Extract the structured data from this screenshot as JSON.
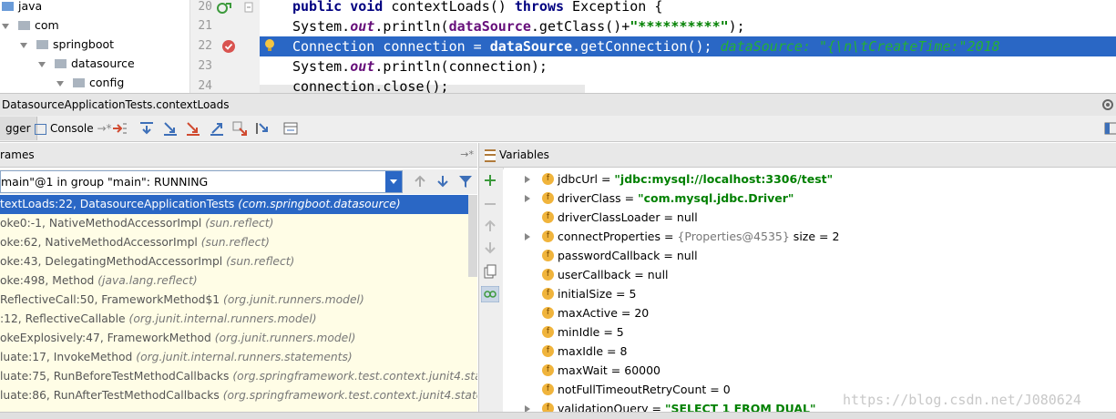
{
  "tree": {
    "items": [
      {
        "label": "java",
        "expanded": false
      },
      {
        "label": "com",
        "expanded": true
      },
      {
        "label": "springboot",
        "expanded": true
      },
      {
        "label": "datasource",
        "expanded": true
      },
      {
        "label": "config",
        "expanded": true
      }
    ]
  },
  "editor": {
    "line_numbers": [
      "20",
      "21",
      "22",
      "23",
      "24"
    ],
    "line20": {
      "kw1": "public void",
      "name": " contextLoads() ",
      "kw2": "throws",
      "rest": "  Exception {"
    },
    "line21": {
      "pre": "    System.",
      "out": "out",
      "mid": ".println(",
      "bold": "dataSource",
      "mid2": ".getClass()+",
      "str": "\"**********\"",
      "end": ");"
    },
    "line22": {
      "pre": "    Connection connection = ",
      "bold": "dataSource",
      "rest": ".getConnection();",
      "hint": "  dataSource: \"{\\n\\tCreateTime:\"2018"
    },
    "line23": {
      "pre": "    System.",
      "out": "out",
      "rest": ".println(connection);"
    },
    "line24": {
      "text": "    connection.close();"
    }
  },
  "debug": {
    "title": "DatasourceApplicationTests.contextLoads",
    "tabs": {
      "debugger": "gger",
      "console": "Console"
    }
  },
  "frames": {
    "header": "rames",
    "thread": "main\"@1 in group \"main\": RUNNING",
    "items": [
      {
        "method": "textLoads:22, DatasourceApplicationTests",
        "pkg": "(com.springboot.datasource)",
        "selected": true
      },
      {
        "method": "oke0:-1, NativeMethodAccessorImpl",
        "pkg": "(sun.reflect)"
      },
      {
        "method": "oke:62, NativeMethodAccessorImpl",
        "pkg": "(sun.reflect)"
      },
      {
        "method": "oke:43, DelegatingMethodAccessorImpl",
        "pkg": "(sun.reflect)"
      },
      {
        "method": "oke:498, Method",
        "pkg": "(java.lang.reflect)"
      },
      {
        "method": "ReflectiveCall:50, FrameworkMethod$1",
        "pkg": "(org.junit.runners.model)"
      },
      {
        "method": ":12, ReflectiveCallable",
        "pkg": "(org.junit.internal.runners.model)"
      },
      {
        "method": "okeExplosively:47, FrameworkMethod",
        "pkg": "(org.junit.runners.model)"
      },
      {
        "method": "luate:17, InvokeMethod",
        "pkg": "(org.junit.internal.runners.statements)"
      },
      {
        "method": "luate:75, RunBeforeTestMethodCallbacks",
        "pkg": "(org.springframework.test.context.junit4.statemen"
      },
      {
        "method": "luate:86, RunAfterTestMethodCallbacks",
        "pkg": "(org.springframework.test.context.junit4.statement"
      }
    ]
  },
  "variables": {
    "header": "Variables",
    "items": [
      {
        "expand": true,
        "name": "jdbcUrl",
        "eq": " = ",
        "value": "\"jdbc:mysql://localhost:3306/test\"",
        "kind": "str"
      },
      {
        "expand": true,
        "name": "driverClass",
        "eq": " = ",
        "value": "\"com.mysql.jdbc.Driver\"",
        "kind": "str"
      },
      {
        "expand": false,
        "name": "driverClassLoader",
        "eq": " = ",
        "value": "null",
        "kind": "plain"
      },
      {
        "expand": true,
        "name": "connectProperties",
        "eq": " = ",
        "value": "{Properties@4535}",
        "extra": "  size = 2",
        "kind": "gray"
      },
      {
        "expand": false,
        "name": "passwordCallback",
        "eq": " = ",
        "value": "null",
        "kind": "plain"
      },
      {
        "expand": false,
        "name": "userCallback",
        "eq": " = ",
        "value": "null",
        "kind": "plain"
      },
      {
        "expand": false,
        "name": "initialSize",
        "eq": " = ",
        "value": "5",
        "kind": "plain"
      },
      {
        "expand": false,
        "name": "maxActive",
        "eq": " = ",
        "value": "20",
        "kind": "plain"
      },
      {
        "expand": false,
        "name": "minIdle",
        "eq": " = ",
        "value": "5",
        "kind": "plain"
      },
      {
        "expand": false,
        "name": "maxIdle",
        "eq": " = ",
        "value": "8",
        "kind": "plain"
      },
      {
        "expand": false,
        "name": "maxWait",
        "eq": " = ",
        "value": "60000",
        "kind": "plain"
      },
      {
        "expand": false,
        "name": "notFullTimeoutRetryCount",
        "eq": " = ",
        "value": "0",
        "kind": "plain"
      },
      {
        "expand": true,
        "name": "validationQuery",
        "eq": " = ",
        "value": "\"SELECT 1 FROM DUAL\"",
        "kind": "str"
      }
    ]
  },
  "watermark": "https://blog.csdn.net/J080624",
  "colors": {
    "selection": "#2a67c5",
    "frames_bg": "#fffde6",
    "string": "#008000"
  }
}
